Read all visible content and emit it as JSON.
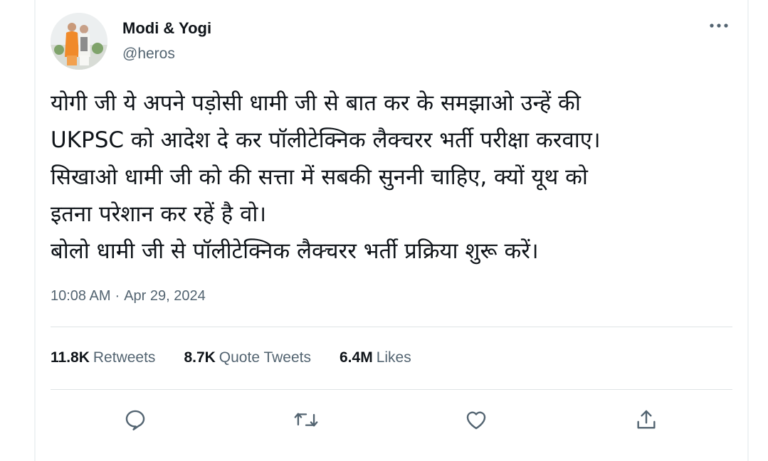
{
  "user": {
    "display_name": "Modi & Yogi",
    "handle": "@heros",
    "avatar_icon": "avatar-photo"
  },
  "tweet": {
    "lines": [
      "योगी जी ये अपने पड़ोसी धामी जी से बात कर के समझाओ उन्हें की",
      "UKPSC को आदेश दे कर पॉलीटेक्निक लैक्चरर भर्ती परीक्षा करवाए।",
      "सिखाओ धामी जी को की सत्ता में सबकी सुननी चाहिए, क्यों यूथ को",
      "इतना परेशान कर रहें है वो।",
      "बोलो धामी जी से पॉलीटेक्निक लैक्चरर भर्ती प्रक्रिया शुरू करें।"
    ],
    "time": "10:08 AM",
    "separator": "·",
    "date": "Apr 29, 2024"
  },
  "stats": {
    "retweets_count": "11.8K",
    "retweets_label": "Retweets",
    "quotes_count": "8.7K",
    "quotes_label": "Quote Tweets",
    "likes_count": "6.4M",
    "likes_label": "Likes"
  },
  "actions": {
    "icons": [
      "reply-icon",
      "retweet-icon",
      "like-icon",
      "share-icon"
    ]
  },
  "colors": {
    "text_primary": "#0f1419",
    "text_secondary": "#536471",
    "divider": "#dfe4e6",
    "icon": "#536471"
  }
}
